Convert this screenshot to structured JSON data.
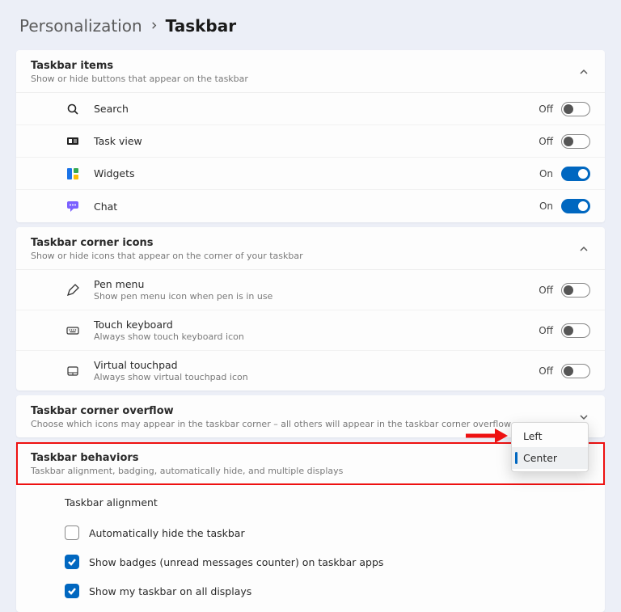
{
  "breadcrumb": {
    "parent": "Personalization",
    "current": "Taskbar"
  },
  "sections": {
    "items": {
      "title": "Taskbar items",
      "sub": "Show or hide buttons that appear on the taskbar",
      "expanded": true,
      "list": [
        {
          "id": "search",
          "label": "Search",
          "state": "Off",
          "on": false
        },
        {
          "id": "taskview",
          "label": "Task view",
          "state": "Off",
          "on": false
        },
        {
          "id": "widgets",
          "label": "Widgets",
          "state": "On",
          "on": true
        },
        {
          "id": "chat",
          "label": "Chat",
          "state": "On",
          "on": true
        }
      ]
    },
    "corner": {
      "title": "Taskbar corner icons",
      "sub": "Show or hide icons that appear on the corner of your taskbar",
      "expanded": true,
      "list": [
        {
          "id": "pen",
          "label": "Pen menu",
          "sublabel": "Show pen menu icon when pen is in use",
          "state": "Off",
          "on": false
        },
        {
          "id": "keyboard",
          "label": "Touch keyboard",
          "sublabel": "Always show touch keyboard icon",
          "state": "Off",
          "on": false
        },
        {
          "id": "touchpad",
          "label": "Virtual touchpad",
          "sublabel": "Always show virtual touchpad icon",
          "state": "Off",
          "on": false
        }
      ]
    },
    "overflow": {
      "title": "Taskbar corner overflow",
      "sub": "Choose which icons may appear in the taskbar corner – all others will appear in the taskbar corner overflow menu",
      "expanded": false
    },
    "behaviors": {
      "title": "Taskbar behaviors",
      "sub": "Taskbar alignment, badging, automatically hide, and multiple displays",
      "expanded": true,
      "alignment": {
        "label": "Taskbar alignment",
        "options": [
          "Left",
          "Center"
        ],
        "selected": "Center"
      },
      "checkboxes": [
        {
          "id": "autohide",
          "label": "Automatically hide the taskbar",
          "checked": false
        },
        {
          "id": "badges",
          "label": "Show badges (unread messages counter) on taskbar apps",
          "checked": true
        },
        {
          "id": "alldisp",
          "label": "Show my taskbar on all displays",
          "checked": true
        }
      ]
    }
  },
  "colors": {
    "accent": "#0067c0",
    "highlight": "#e11"
  }
}
